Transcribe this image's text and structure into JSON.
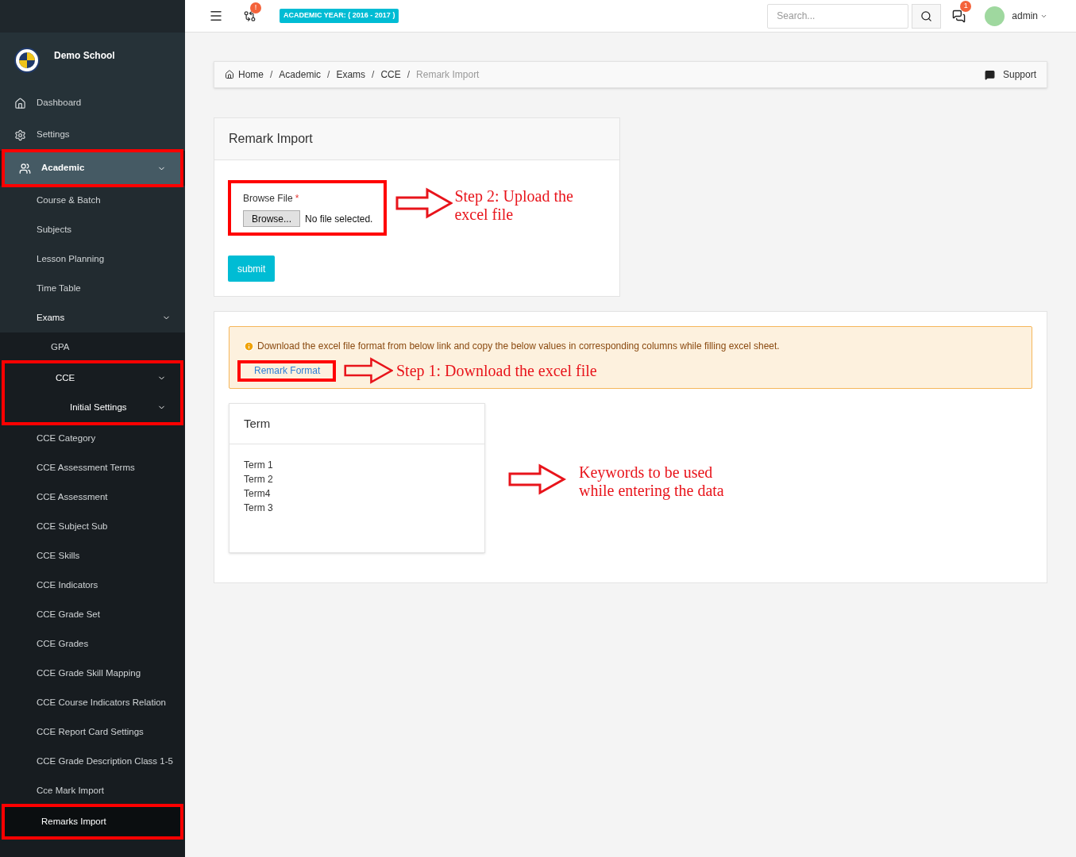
{
  "header": {
    "notification_badge": "!",
    "academic_year": "ACADEMIC YEAR: ( 2016 - 2017 )",
    "search": {
      "placeholder": "Search..."
    },
    "message_badge": "1",
    "user": "admin"
  },
  "sidebar": {
    "school_name": "Demo School",
    "items": [
      {
        "label": "Dashboard",
        "expanded": false,
        "selected": false,
        "highlighted": false
      },
      {
        "label": "Settings",
        "expanded": false,
        "selected": false,
        "highlighted": false
      },
      {
        "label": "Academic",
        "expanded": true,
        "selected": false,
        "highlighted": true,
        "children": [
          {
            "label": "Course & Batch",
            "expanded": false,
            "selected": false,
            "highlighted": false
          },
          {
            "label": "Subjects",
            "expanded": false,
            "selected": false,
            "highlighted": false
          },
          {
            "label": "Lesson Planning",
            "expanded": false,
            "selected": false,
            "highlighted": false
          },
          {
            "label": "Time Table",
            "expanded": false,
            "selected": false,
            "highlighted": false
          },
          {
            "label": "Exams",
            "expanded": true,
            "selected": false,
            "highlighted": false,
            "children": [
              {
                "label": "GPA",
                "expanded": false,
                "selected": false,
                "highlighted": false
              },
              {
                "label": "CCE",
                "expanded": true,
                "selected": false,
                "highlighted": true,
                "children": [
                  {
                    "label": "Initial Settings",
                    "expanded": true,
                    "selected": false,
                    "highlighted": true,
                    "children": [
                      {
                        "label": "CCE Category",
                        "selected": false,
                        "highlighted": false
                      },
                      {
                        "label": "CCE Assessment Terms",
                        "selected": false,
                        "highlighted": false
                      },
                      {
                        "label": "CCE Assessment",
                        "selected": false,
                        "highlighted": false
                      },
                      {
                        "label": "CCE Subject Sub",
                        "selected": false,
                        "highlighted": false
                      },
                      {
                        "label": "CCE Skills",
                        "selected": false,
                        "highlighted": false
                      },
                      {
                        "label": "CCE Indicators",
                        "selected": false,
                        "highlighted": false
                      },
                      {
                        "label": "CCE Grade Set",
                        "selected": false,
                        "highlighted": false
                      },
                      {
                        "label": "CCE Grades",
                        "selected": false,
                        "highlighted": false
                      },
                      {
                        "label": "CCE Grade Skill Mapping",
                        "selected": false,
                        "highlighted": false
                      },
                      {
                        "label": "CCE Course Indicators Relation",
                        "selected": false,
                        "highlighted": false
                      },
                      {
                        "label": "CCE Report Card Settings",
                        "selected": false,
                        "highlighted": false
                      },
                      {
                        "label": "CCE Grade Description Class 1-5",
                        "selected": false,
                        "highlighted": false
                      },
                      {
                        "label": "Cce Mark Import",
                        "selected": false,
                        "highlighted": false
                      },
                      {
                        "label": "Remarks Import",
                        "selected": true,
                        "highlighted": true
                      }
                    ]
                  }
                ]
              }
            ]
          }
        ]
      }
    ]
  },
  "breadcrumb": {
    "items": [
      "Home",
      "Academic",
      "Exams",
      "CCE",
      "Remark Import"
    ],
    "separators": [
      "/",
      "/",
      "/",
      "/"
    ],
    "support": "Support"
  },
  "upload_form": {
    "title": "Remark Import",
    "field_label": "Browse File",
    "required_mark": "*",
    "browse_button": "Browse...",
    "file_status": "No file selected.",
    "highlighted": true,
    "annotation": "Step 2: Upload the excel file",
    "submit": "submit"
  },
  "notice": {
    "text": "Download the excel file format from below link and copy the below values in corresponding columns while filling excel sheet.",
    "link": "Remark Format",
    "highlighted": true,
    "annotation": "Step 1: Download the excel file"
  },
  "term_panel": {
    "title": "Term",
    "terms": [
      "Term 1",
      "Term 2",
      "Term4",
      "Term 3"
    ],
    "annotation": "Keywords to be used while entering the data"
  }
}
